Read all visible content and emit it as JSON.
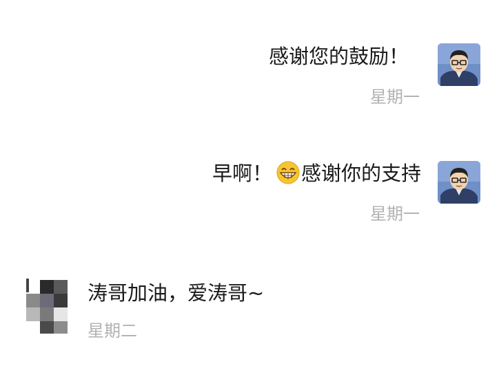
{
  "chat": {
    "messages": [
      {
        "side": "right",
        "text": "感谢您的鼓励！",
        "time": "星期一",
        "avatar_icon": "self-avatar-cartoon"
      },
      {
        "side": "right",
        "text_before_emoji": "早啊！",
        "emoji_icon": "grinning-emoji",
        "text_after_emoji": "感谢你的支持",
        "time": "星期一",
        "avatar_icon": "self-avatar-cartoon"
      },
      {
        "side": "left",
        "text": "涛哥加油，爱涛哥~",
        "time": "星期二",
        "avatar_icon": "mosaic-avatar"
      }
    ]
  },
  "colors": {
    "text": "#1a1a1a",
    "timestamp": "#b2b2b2",
    "avatar_bg": "#6f8fc8",
    "emoji": "#f7c531"
  }
}
